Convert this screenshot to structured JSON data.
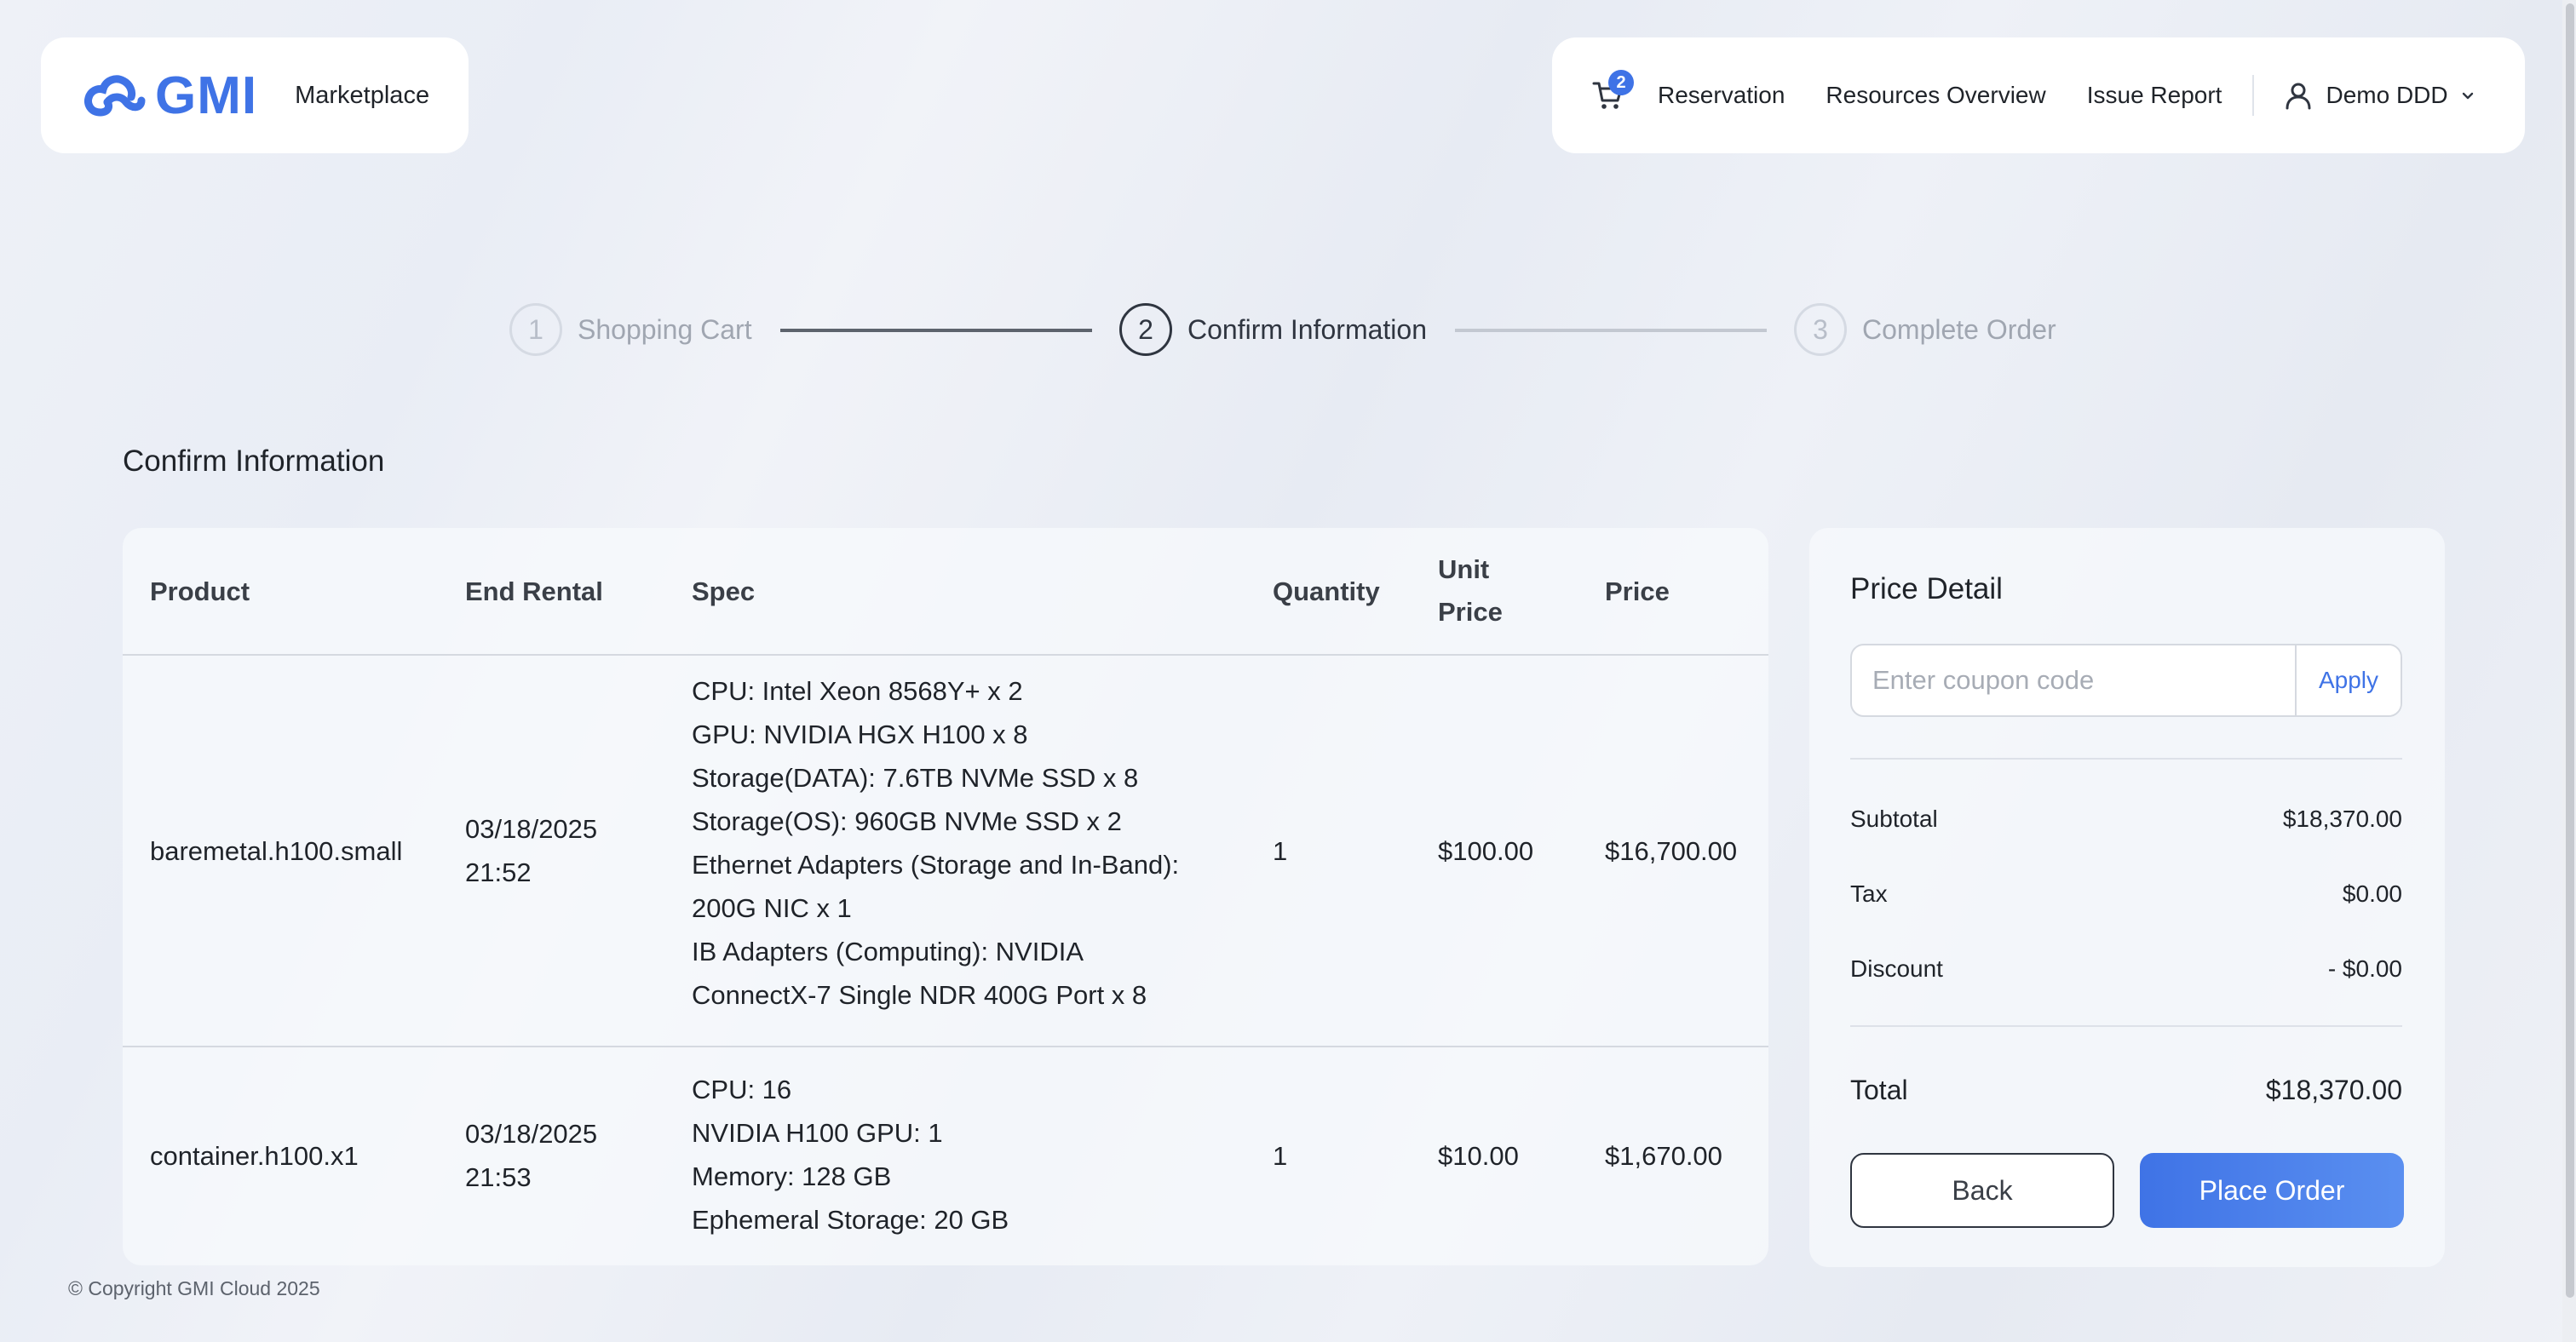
{
  "header": {
    "logo_text": "GMI",
    "marketplace": "Marketplace",
    "cart_count": "2",
    "nav": [
      "Reservation",
      "Resources Overview",
      "Issue Report"
    ],
    "user": "Demo DDD"
  },
  "stepper": {
    "steps": [
      {
        "num": "1",
        "label": "Shopping Cart"
      },
      {
        "num": "2",
        "label": "Confirm Information"
      },
      {
        "num": "3",
        "label": "Complete Order"
      }
    ],
    "active_step": 2
  },
  "section_title": "Confirm Information",
  "table": {
    "headers": {
      "product": "Product",
      "end_rental": "End Rental",
      "spec": "Spec",
      "quantity": "Quantity",
      "unit_price_1": "Unit",
      "unit_price_2": "Price",
      "price": "Price"
    },
    "rows": [
      {
        "product": "baremetal.h100.small",
        "end_date": "03/18/2025",
        "end_time": "21:52",
        "spec": [
          "CPU: Intel Xeon 8568Y+ x 2",
          "GPU: NVIDIA HGX H100 x 8",
          "Storage(DATA): 7.6TB NVMe SSD x 8",
          "Storage(OS): 960GB NVMe SSD x 2",
          "Ethernet Adapters (Storage and In-Band):",
          "200G NIC x 1",
          "IB Adapters (Computing): NVIDIA",
          "ConnectX-7 Single NDR 400G Port x 8"
        ],
        "quantity": "1",
        "unit_price": "$100.00",
        "price": "$16,700.00"
      },
      {
        "product": "container.h100.x1",
        "end_date": "03/18/2025",
        "end_time": "21:53",
        "spec": [
          "CPU: 16",
          "NVIDIA H100 GPU: 1",
          "Memory: 128 GB",
          "Ephemeral Storage: 20 GB"
        ],
        "quantity": "1",
        "unit_price": "$10.00",
        "price": "$1,670.00"
      }
    ]
  },
  "price_detail": {
    "title": "Price Detail",
    "coupon_placeholder": "Enter coupon code",
    "coupon_value": "",
    "apply_label": "Apply",
    "subtotal_label": "Subtotal",
    "subtotal": "$18,370.00",
    "tax_label": "Tax",
    "tax": "$0.00",
    "discount_label": "Discount",
    "discount": "- $0.00",
    "total_label": "Total",
    "total": "$18,370.00",
    "back_label": "Back",
    "place_order_label": "Place Order"
  },
  "footer": "© Copyright GMI Cloud 2025",
  "colors": {
    "accent": "#3f73e6",
    "text": "#1f2329",
    "muted": "#a0a6b1"
  }
}
